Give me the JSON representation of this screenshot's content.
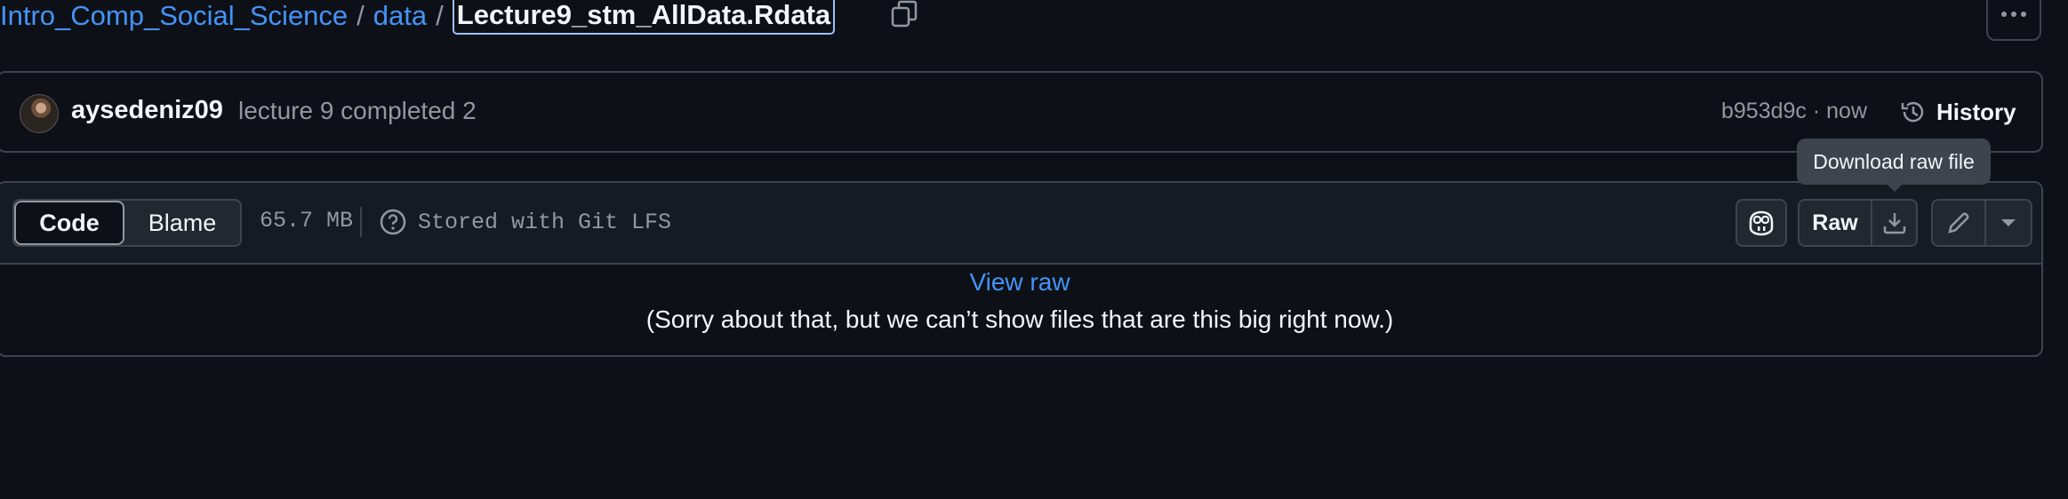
{
  "breadcrumb": {
    "repo": "Intro_Comp_Social_Science",
    "folder": "data",
    "separator": "/",
    "file": "Lecture9_stm_AllData.Rdata"
  },
  "commit": {
    "author": "aysedeniz09",
    "message": "lecture 9 completed 2",
    "meta": "b953d9c · now",
    "history_label": "History"
  },
  "tooltip": "Download raw file",
  "file_header": {
    "code_label": "Code",
    "blame_label": "Blame",
    "size": "65.7 MB",
    "lfs_text": "Stored with Git LFS",
    "raw_label": "Raw"
  },
  "body": {
    "view_raw": "View raw",
    "notice": "(Sorry about that, but we can’t show files that are this big right now.)"
  },
  "icons": [
    "copy-icon",
    "kebab-icon",
    "history-icon",
    "question-icon",
    "copilot-icon",
    "download-icon",
    "pencil-icon",
    "caret-down-icon"
  ],
  "colors": {
    "background": "#0d1117",
    "link": "#4493f8",
    "border": "#3d444d",
    "muted": "#9198a1"
  }
}
